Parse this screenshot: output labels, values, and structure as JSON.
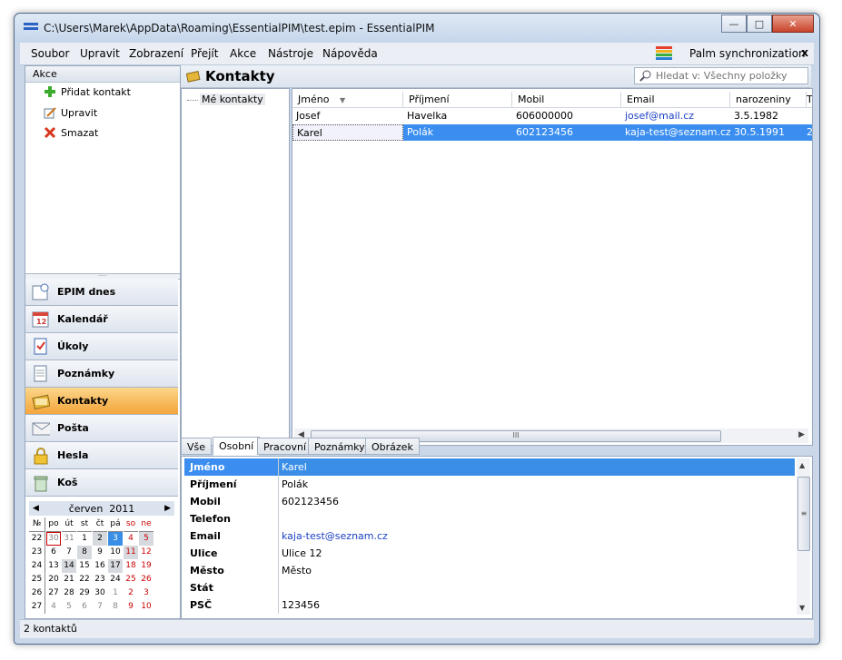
{
  "window": {
    "title": "C:\\Users\\Marek\\AppData\\Roaming\\EssentialPIM\\test.epim - EssentialPIM"
  },
  "menu": {
    "items": [
      "Soubor",
      "Upravit",
      "Zobrazení",
      "Přejít",
      "Akce",
      "Nástroje",
      "Nápověda"
    ],
    "palm_sync": "Palm synchronization",
    "close": "x"
  },
  "actions": {
    "header": "Akce",
    "items": [
      {
        "label": "Přidat kontakt",
        "icon": "add-icon"
      },
      {
        "label": "Upravit",
        "icon": "edit-icon"
      },
      {
        "label": "Smazat",
        "icon": "delete-icon"
      }
    ]
  },
  "nav": {
    "items": [
      {
        "label": "EPIM dnes",
        "icon": "today-icon",
        "active": false
      },
      {
        "label": "Kalendář",
        "icon": "calendar-icon",
        "active": false
      },
      {
        "label": "Úkoly",
        "icon": "tasks-icon",
        "active": false
      },
      {
        "label": "Poznámky",
        "icon": "notes-icon",
        "active": false
      },
      {
        "label": "Kontakty",
        "icon": "contacts-icon",
        "active": true
      },
      {
        "label": "Pošta",
        "icon": "mail-icon",
        "active": false
      },
      {
        "label": "Hesla",
        "icon": "lock-icon",
        "active": false
      },
      {
        "label": "Koš",
        "icon": "trash-icon",
        "active": false
      }
    ]
  },
  "calendar": {
    "month": "červen",
    "year": "2011",
    "prev": "◀",
    "next": "▶",
    "headers": [
      "№",
      "po",
      "út",
      "st",
      "čt",
      "pá",
      "so",
      "ne"
    ],
    "weeks": [
      {
        "cw": "22",
        "days": [
          "30",
          "31",
          "1",
          "2",
          "3",
          "4",
          "5"
        ]
      },
      {
        "cw": "23",
        "days": [
          "6",
          "7",
          "8",
          "9",
          "10",
          "11",
          "12"
        ]
      },
      {
        "cw": "24",
        "days": [
          "13",
          "14",
          "15",
          "16",
          "17",
          "18",
          "19"
        ]
      },
      {
        "cw": "25",
        "days": [
          "20",
          "21",
          "22",
          "23",
          "24",
          "25",
          "26"
        ]
      },
      {
        "cw": "26",
        "days": [
          "27",
          "28",
          "29",
          "30",
          "1",
          "2",
          "3"
        ]
      },
      {
        "cw": "27",
        "days": [
          "4",
          "5",
          "6",
          "7",
          "8",
          "9",
          "10"
        ]
      }
    ]
  },
  "header": {
    "title": "Kontakty",
    "search_placeholder": "Hledat v: Všechny položky"
  },
  "tree": {
    "items": [
      "Mé kontakty"
    ]
  },
  "grid": {
    "columns": [
      "Jméno",
      "Příjmení",
      "Mobil",
      "Email",
      "narozeniny",
      "T"
    ],
    "rows": [
      {
        "first": "Josef",
        "last": "Havelka",
        "mobile": "606000000",
        "email": "josef@mail.cz",
        "birthday": "3.5.1982",
        "extra": "",
        "selected": false
      },
      {
        "first": "Karel",
        "last": "Polák",
        "mobile": "602123456",
        "email": "kaja-test@seznam.cz",
        "birthday": "30.5.1991",
        "extra": "2",
        "selected": true
      }
    ],
    "hscroll_grip": "III"
  },
  "tabs": [
    "Vše",
    "Osobní",
    "Pracovní",
    "Poznámky",
    "Obrázek"
  ],
  "active_tab": "Osobní",
  "detail": {
    "rows": [
      {
        "label": "Jméno",
        "value": "Karel"
      },
      {
        "label": "Příjmení",
        "value": "Polák"
      },
      {
        "label": "Mobil",
        "value": "602123456"
      },
      {
        "label": "Telefon",
        "value": ""
      },
      {
        "label": "Email",
        "value": "kaja-test@seznam.cz"
      },
      {
        "label": "Ulice",
        "value": "Ulice 12"
      },
      {
        "label": "Město",
        "value": "Město"
      },
      {
        "label": "Stát",
        "value": ""
      },
      {
        "label": "PSČ",
        "value": "123456"
      }
    ]
  },
  "status": {
    "text": "2 kontaktů"
  },
  "colors": {
    "accent": "#3b8ef0",
    "active_nav": "#f4a53a",
    "link": "#1b3fc5"
  }
}
